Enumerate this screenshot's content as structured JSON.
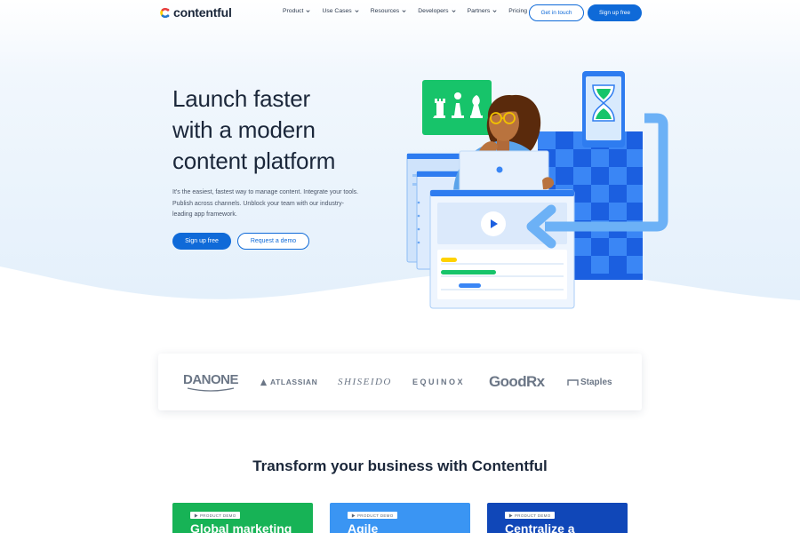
{
  "colors": {
    "brand_blue": "#0f6ad8",
    "text_dark": "#1b273a",
    "hero_bg": "#eaf3fc",
    "card_green": "#17b356",
    "card_sky": "#3a95f3",
    "card_navy": "#1047b8"
  },
  "header": {
    "logo_text": "contentful",
    "nav": [
      {
        "label": "Product",
        "has_dropdown": true
      },
      {
        "label": "Use Cases",
        "has_dropdown": true
      },
      {
        "label": "Resources",
        "has_dropdown": true
      },
      {
        "label": "Developers",
        "has_dropdown": true
      },
      {
        "label": "Partners",
        "has_dropdown": true
      },
      {
        "label": "Pricing",
        "has_dropdown": false
      }
    ],
    "get_in_touch": "Get in touch",
    "sign_up": "Sign up free"
  },
  "hero": {
    "title_lines": [
      "Launch faster",
      "with a modern",
      "content platform"
    ],
    "description": "It's the easiest, fastest way to manage content. Integrate your tools. Publish across channels. Unblock your team with our industry-leading app framework.",
    "primary_button": "Sign up free",
    "secondary_button": "Request a demo"
  },
  "logos": {
    "danone": "DANONE",
    "atlassian": "ATLASSIAN",
    "shiseido": "SHISEIDO",
    "equinox": "EQUINOX",
    "goodrx": "GoodRx",
    "staples": "Staples"
  },
  "section": {
    "title": "Transform your business with Contentful"
  },
  "cards": [
    {
      "badge": "PRODUCT DEMO",
      "title": "Global marketing"
    },
    {
      "badge": "PRODUCT DEMO",
      "title": "Agile"
    },
    {
      "badge": "PRODUCT DEMO",
      "title": "Centralize a"
    }
  ]
}
